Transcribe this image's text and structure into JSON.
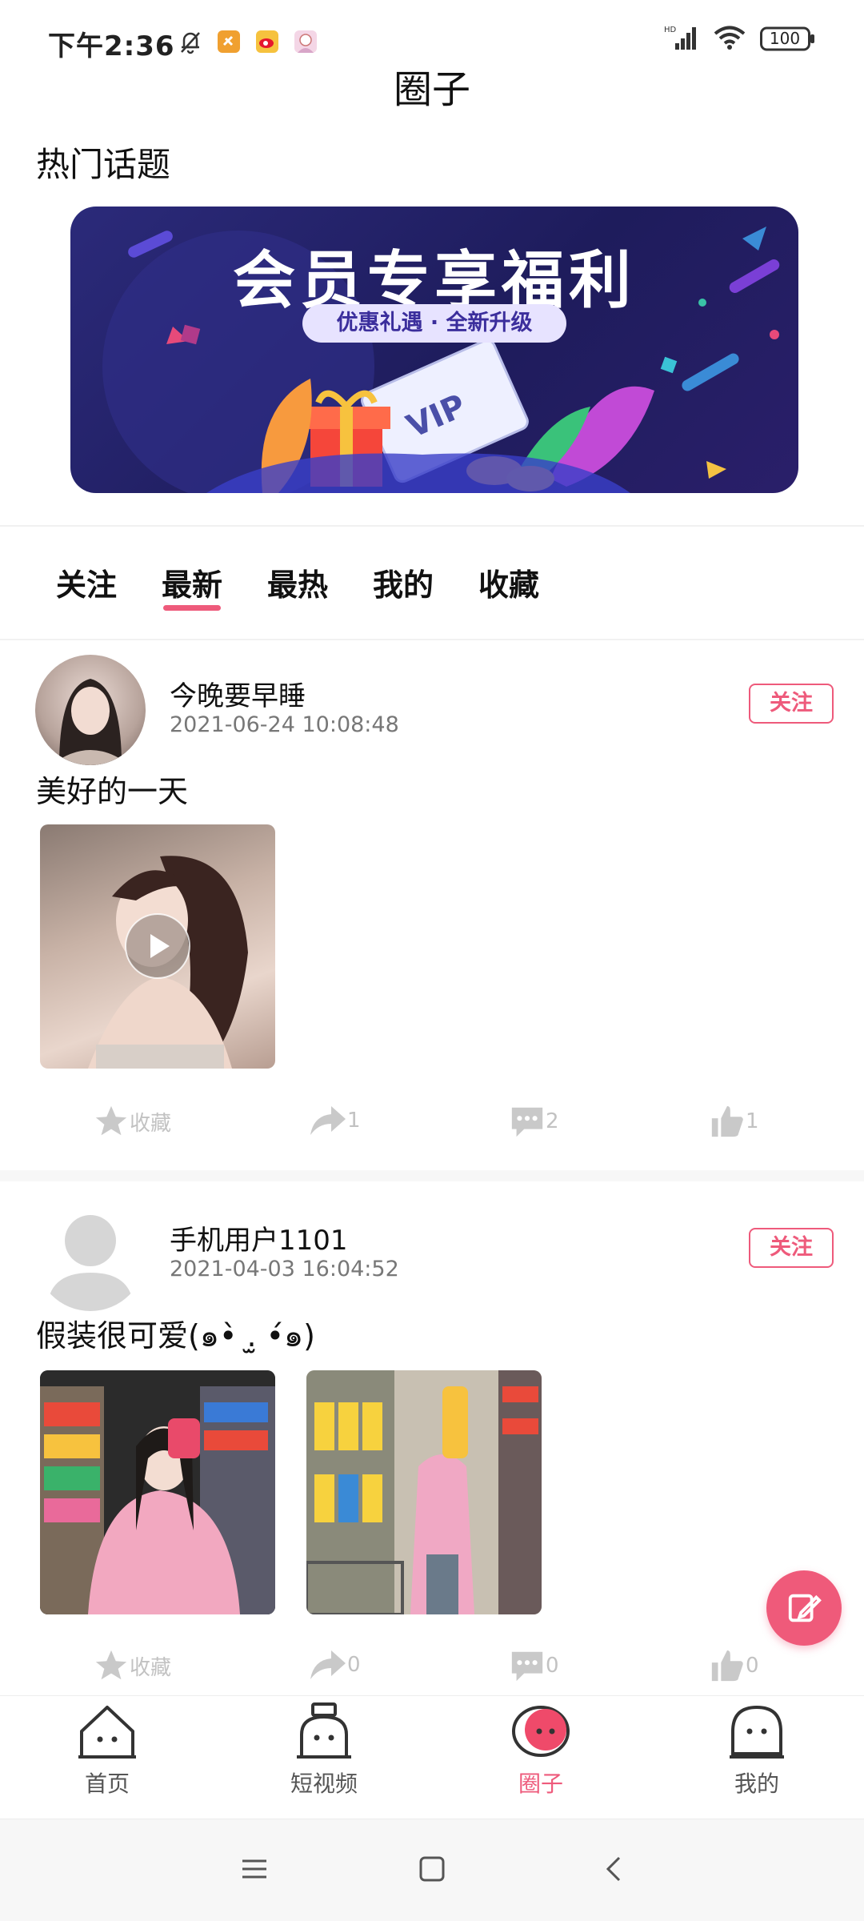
{
  "status_bar": {
    "time": "下午2:36",
    "network_label": "HD",
    "battery": "100"
  },
  "page": {
    "title": "圈子",
    "section_title": "热门话题"
  },
  "banner": {
    "title": "会员专享福利",
    "subtitle": "优惠礼遇 · 全新升级",
    "badge": "VIP"
  },
  "tabs": [
    {
      "label": "关注",
      "active": false
    },
    {
      "label": "最新",
      "active": true
    },
    {
      "label": "最热",
      "active": false
    },
    {
      "label": "我的",
      "active": false
    },
    {
      "label": "收藏",
      "active": false
    }
  ],
  "posts": [
    {
      "username": "今晚要早睡",
      "time": "2021-06-24 10:08:48",
      "text": "美好的一天",
      "follow_label": "关注",
      "favorite_label": "收藏",
      "share_count": "1",
      "comment_count": "2",
      "like_count": "1"
    },
    {
      "username": "手机用户1101",
      "time": "2021-04-03 16:04:52",
      "text": "假装很可爱(๑•̀ .̫ •́๑)",
      "follow_label": "关注",
      "favorite_label": "收藏",
      "share_count": "0",
      "comment_count": "0",
      "like_count": "0"
    }
  ],
  "bottom_nav": [
    {
      "label": "首页",
      "icon": "home-face-icon",
      "active": false
    },
    {
      "label": "短视频",
      "icon": "video-robot-icon",
      "active": false
    },
    {
      "label": "圈子",
      "icon": "circle-bubble-icon",
      "active": true
    },
    {
      "label": "我的",
      "icon": "profile-face-icon",
      "active": false
    }
  ],
  "colors": {
    "accent": "#ee5a7b",
    "banner_bg": "#1e1c5c",
    "muted_icon": "#c2c2c2"
  }
}
